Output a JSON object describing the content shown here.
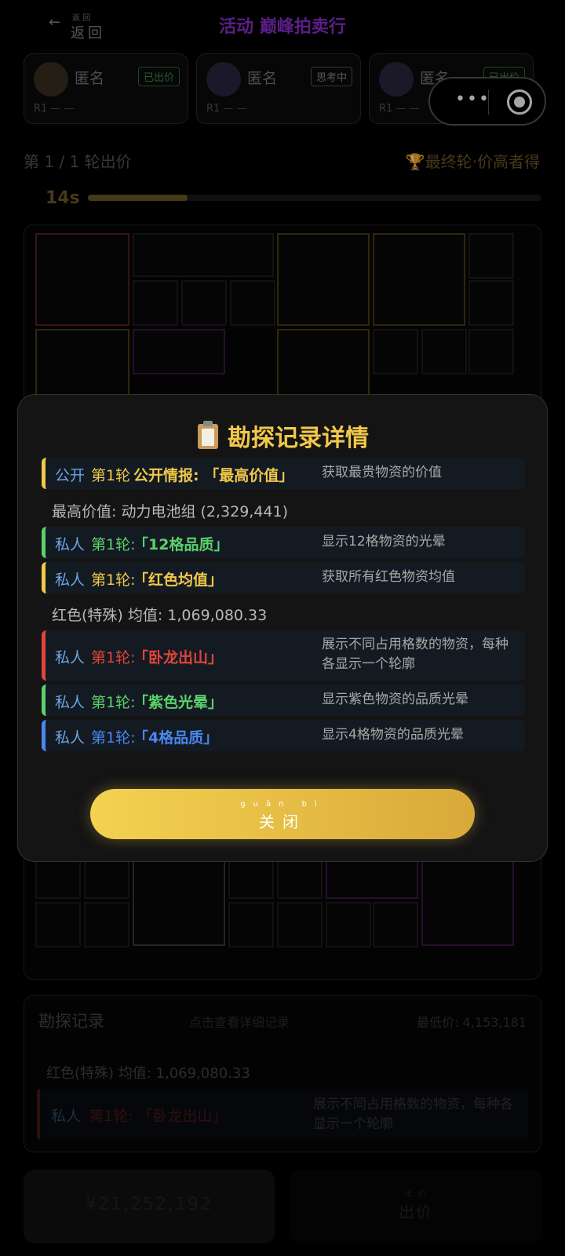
{
  "header": {
    "back_arrow": "←",
    "back_ruby": "返 回",
    "back_label": "返回",
    "title": "活动 巅峰拍卖行"
  },
  "players": [
    {
      "name": "匿名",
      "status": "已出价",
      "round": "R1 — —",
      "avatar": "avatar-icon"
    },
    {
      "name": "匿名",
      "status": "思考中",
      "round": "R1 — —",
      "avatar": "avatar-icon"
    },
    {
      "name": "匿名",
      "status": "已出价",
      "round": "R1 — —",
      "avatar": "avatar-icon"
    }
  ],
  "capsule": {
    "more_glyph": "•••",
    "target_icon": "target-icon"
  },
  "round": {
    "label": "第 1 / 1 轮出价",
    "final_label": "🏆最终轮·价高者得",
    "timer": "14s",
    "progress": 0.22
  },
  "record_panel": {
    "title": "勘探记录",
    "hint": "点击查看详细记录",
    "min_price": "最低价: 4,153,181",
    "avg_note": "红色(特殊) 均值: 1,069,080.33",
    "item": {
      "who": "私人",
      "round": "第1轮: 「卧龙出山」",
      "desc": "展示不同占用格数的物资，每种各显示一个轮廓"
    }
  },
  "bottom": {
    "left_value": "¥21,252,192",
    "right_ruby": "出 价",
    "right_label": "出价"
  },
  "modal": {
    "title": "勘探记录详情",
    "title_icon": "clipboard-icon",
    "records": [
      {
        "who": "公开",
        "round": "第1轮",
        "ability": "公开情报: 「最高价值」",
        "desc": "获取最贵物资的价值",
        "accent": "#f1c84a"
      },
      {
        "note": "最高价值: 动力电池组 (2,329,441)"
      },
      {
        "who": "私人",
        "round": "第1轮:",
        "ability": "「12格品质」",
        "desc": "显示12格物资的光晕",
        "accent": "#5ad16a"
      },
      {
        "who": "私人",
        "round": "第1轮:",
        "ability": "「红色均值」",
        "desc": "获取所有红色物资均值",
        "accent": "#f1c84a"
      },
      {
        "note": "红色(特殊) 均值: 1,069,080.33"
      },
      {
        "who": "私人",
        "round": "第1轮:",
        "ability": "「卧龙出山」",
        "desc": "展示不同占用格数的物资，每种各显示一个轮廓",
        "accent": "#e0453a"
      },
      {
        "who": "私人",
        "round": "第1轮:",
        "ability": "「紫色光晕」",
        "desc": "显示紫色物资的品质光晕",
        "accent": "#5ad16a"
      },
      {
        "who": "私人",
        "round": "第1轮:",
        "ability": "「4格品质」",
        "desc": "显示4格物资的品质光晕",
        "accent": "#4a86f0"
      }
    ],
    "close_ruby": "guān bì",
    "close_label": "关闭"
  }
}
